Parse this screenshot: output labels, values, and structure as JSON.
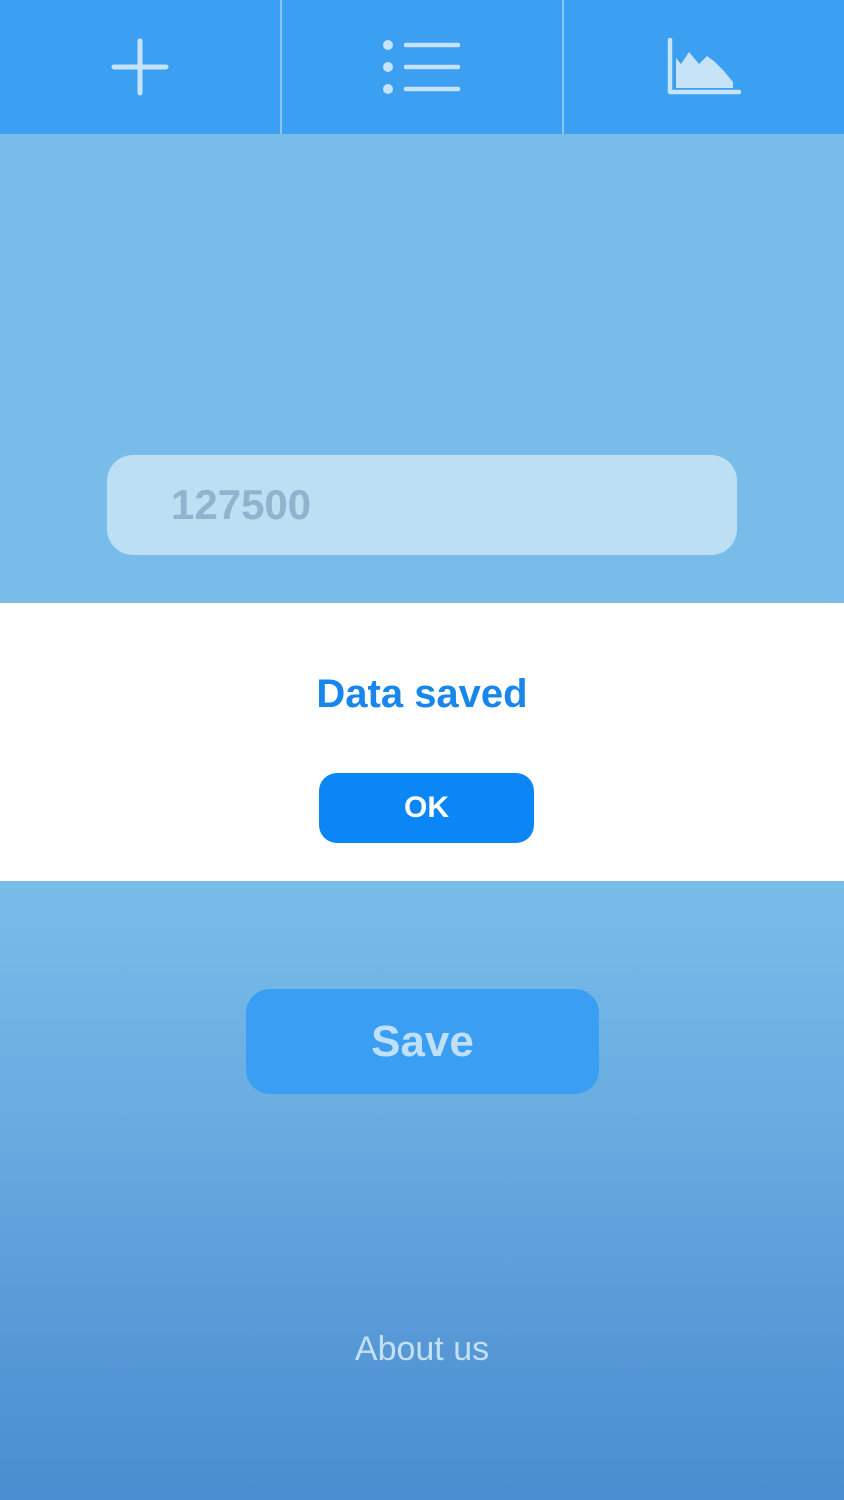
{
  "tabs": [
    {
      "id": "add",
      "icon": "plus-icon"
    },
    {
      "id": "list",
      "icon": "list-icon"
    },
    {
      "id": "chart",
      "icon": "area-chart-icon"
    }
  ],
  "form": {
    "amount_value": "127500"
  },
  "buttons": {
    "save_label": "Save"
  },
  "footer": {
    "about_label": "About us"
  },
  "dialog": {
    "title": "Data saved",
    "ok_label": "OK"
  },
  "colors": {
    "tabbar": "#3b9ff2",
    "background": "#78bde9",
    "dialog_title": "#1787ec",
    "ok_button": "#0a86f7",
    "icon": "#c6e3f8"
  }
}
